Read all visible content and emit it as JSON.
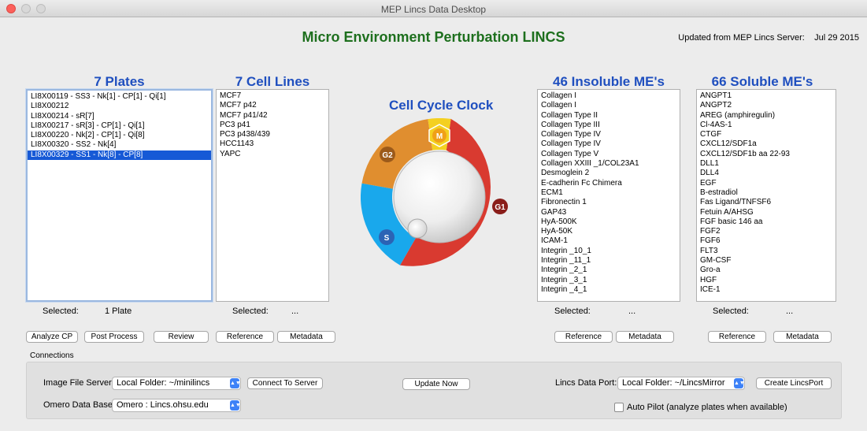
{
  "window": {
    "title": "MEP Lincs Data Desktop"
  },
  "app": {
    "title": "Micro Environment Perturbation LINCS",
    "updated_label": "Updated from MEP Lincs Server:",
    "updated_date": "Jul 29 2015"
  },
  "plates": {
    "heading": "7 Plates",
    "items": [
      "LI8X00119 - SS3 - Nk[1] - CP[1] - Qi[1]",
      "LI8X00212",
      "LI8X00214 - sR[7]",
      "LI8X00217 - sR[3] - CP[1] - Qi[1]",
      "LI8X00220 - Nk[2] - CP[1] - Qi[8]",
      "LI8X00320 - SS2 - Nk[4]",
      "LI8X00329 - SS1 - Nk[8] - CP[8]"
    ],
    "selected_index": 6,
    "selected_label": "Selected:",
    "selected_value": "1 Plate",
    "buttons": {
      "analyze": "Analyze CP",
      "post": "Post Process",
      "review": "Review"
    }
  },
  "cell_lines": {
    "heading": "7 Cell Lines",
    "items": [
      "MCF7",
      "MCF7 p42",
      "MCF7 p41/42",
      "PC3 p41",
      "PC3 p438/439",
      "HCC1143",
      "YAPC"
    ],
    "selected_label": "Selected:",
    "selected_value": "...",
    "buttons": {
      "reference": "Reference",
      "metadata": "Metadata"
    }
  },
  "clock": {
    "title": "Cell Cycle Clock",
    "phases": {
      "g1": "G1",
      "s": "S",
      "g2": "G2",
      "m": "M"
    }
  },
  "insoluble": {
    "heading": "46 Insoluble ME's",
    "items": [
      "Collagen I",
      "Collagen I",
      "Collagen Type II",
      "Collagen Type III",
      "Collagen Type IV",
      "Collagen Type IV",
      "Collagen Type V",
      "Collagen XXIII _1/COL23A1",
      "Desmoglein 2",
      "E-cadherin Fc Chimera",
      "ECM1",
      "Fibronectin 1",
      "GAP43",
      "HyA-500K",
      "HyA-50K",
      "ICAM-1",
      "Integrin _10_1",
      "Integrin _11_1",
      "Integrin _2_1",
      "Integrin _3_1",
      "Integrin _4_1"
    ],
    "selected_label": "Selected:",
    "selected_value": "...",
    "buttons": {
      "reference": "Reference",
      "metadata": "Metadata"
    }
  },
  "soluble": {
    "heading": "66 Soluble ME's",
    "items": [
      "ANGPT1",
      "ANGPT2",
      "AREG (amphiregulin)",
      "Cl-4AS-1",
      "CTGF",
      "CXCL12/SDF1a",
      "CXCL12/SDF1b aa 22-93",
      "DLL1",
      "DLL4",
      "EGF",
      "B-estradiol",
      "Fas Ligand/TNFSF6",
      "Fetuin A/AHSG",
      "FGF basic 146 aa",
      "FGF2",
      "FGF6",
      "FLT3",
      "GM-CSF",
      "Gro-a",
      "HGF",
      "ICE-1"
    ],
    "selected_label": "Selected:",
    "selected_value": "...",
    "buttons": {
      "reference": "Reference",
      "metadata": "Metadata"
    }
  },
  "connections": {
    "label": "Connections",
    "image_server_label": "Image File Server:",
    "image_server_value": "Local Folder: ~/minilincs",
    "connect_button": "Connect To Server",
    "update_button": "Update Now",
    "lincs_port_label": "Lincs Data Port:",
    "lincs_port_value": "Local Folder: ~/LincsMirror",
    "create_port_button": "Create LincsPort",
    "omero_label": "Omero Data Base:",
    "omero_value": "Omero : Lincs.ohsu.edu",
    "autopilot_label": "Auto Pilot (analyze plates when available)",
    "autopilot_checked": false
  },
  "colors": {
    "title_green": "#1d6f1d",
    "heading_blue": "#1f4fbf",
    "selection_blue": "#1659d6",
    "g1_red": "#d93a30",
    "s_blue": "#19a8ec",
    "g2_orange": "#e08e2f",
    "m_yellow": "#f4d020"
  }
}
